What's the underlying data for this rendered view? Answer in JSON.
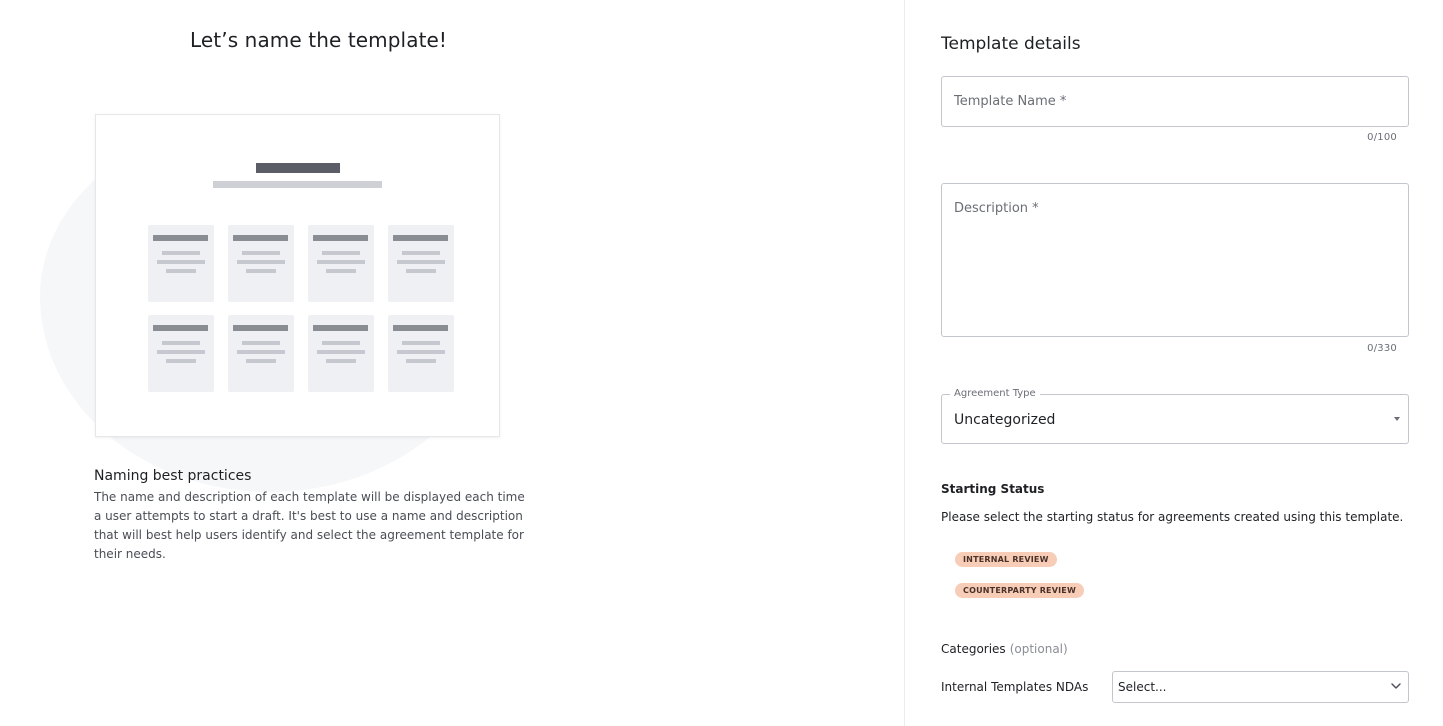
{
  "left": {
    "title": "Let’s name the template!",
    "best_practices_title": "Naming best practices",
    "best_practices_text": "The name and description of each template will be displayed each time a user attempts to start a draft. It's best to use a name and description that will best help users identify and select the agreement template for their needs."
  },
  "right": {
    "section_title": "Template details",
    "template_name": {
      "label": "Template Name *",
      "value": "",
      "counter": "0/100"
    },
    "description": {
      "label": "Description *",
      "value": "",
      "counter": "0/330"
    },
    "agreement_type": {
      "label": "Agreement Type",
      "value": "Uncategorized"
    },
    "starting_status": {
      "title": "Starting Status",
      "help": "Please select the starting status for agreements created using this template.",
      "options": [
        "INTERNAL REVIEW",
        "COUNTERPARTY REVIEW"
      ]
    },
    "categories": {
      "title": "Categories",
      "optional": "(optional)",
      "field_label": "Internal Templates NDAs",
      "placeholder": "Select..."
    }
  },
  "colors": {
    "pill_bg": "#f7cdb8",
    "border": "#c3c6cc",
    "text_muted": "#6b6e76"
  },
  "icons": {
    "agreement_caret": "caret-down-icon",
    "category_chevron": "chevron-down-icon"
  }
}
